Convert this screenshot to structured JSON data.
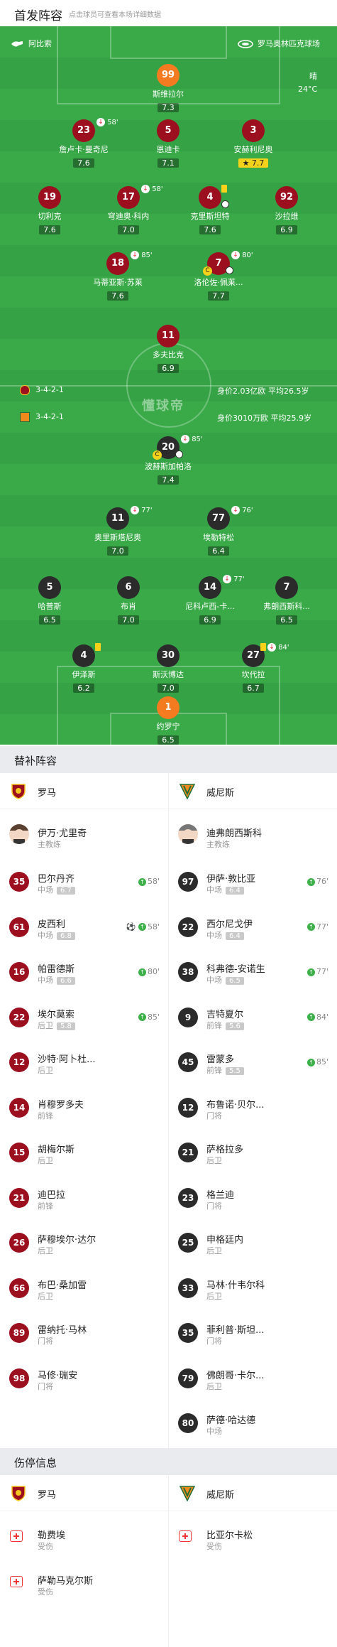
{
  "header": {
    "title": "首发阵容",
    "hint": "点击球员可查看本场详细数据"
  },
  "match": {
    "home_team": "阿比索",
    "stadium": "罗马奥林匹克球场",
    "weather": "晴",
    "temperature": "24°C",
    "watermark": "懂球帝"
  },
  "formations": {
    "home": {
      "formation": "3-4-2-1",
      "value": "身价2.03亿欧",
      "avg_age": "平均26.5岁"
    },
    "away": {
      "formation": "3-4-2-1",
      "value": "身价3010万欧",
      "avg_age": "平均25.9岁"
    }
  },
  "home_lineup": [
    {
      "num": "99",
      "name": "斯维拉尔",
      "rating": "7.3",
      "gk": true
    },
    {
      "num": "23",
      "name": "詹卢卡·曼奇尼",
      "rating": "7.6",
      "sub": "58'"
    },
    {
      "num": "5",
      "name": "恩迪卡",
      "rating": "7.1"
    },
    {
      "num": "3",
      "name": "安赫利尼奥",
      "rating": "7.7",
      "star": "7.7"
    },
    {
      "num": "19",
      "name": "切利克",
      "rating": "7.6"
    },
    {
      "num": "17",
      "name": "穹迪奥·科内",
      "rating": "7.0",
      "sub": "58'"
    },
    {
      "num": "4",
      "name": "克里斯坦特",
      "rating": "7.6",
      "card": true,
      "goal": true
    },
    {
      "num": "92",
      "name": "沙拉维",
      "rating": "6.9"
    },
    {
      "num": "18",
      "name": "马蒂亚斯·苏莱",
      "rating": "7.6",
      "sub": "85'"
    },
    {
      "num": "7",
      "name": "洛伦佐·佩莱...",
      "rating": "7.7",
      "sub": "80'",
      "captain": "C",
      "assist": true
    },
    {
      "num": "11",
      "name": "多夫比克",
      "rating": "6.9"
    }
  ],
  "away_lineup": [
    {
      "num": "20",
      "name": "波赫斯加帕洛",
      "rating": "7.4",
      "sub": "85'",
      "captain": "C",
      "goal": true
    },
    {
      "num": "11",
      "name": "奥里斯塔尼奥",
      "rating": "7.0",
      "sub": "77'"
    },
    {
      "num": "77",
      "name": "埃勒特松",
      "rating": "6.4",
      "sub": "76'"
    },
    {
      "num": "5",
      "name": "哈普斯",
      "rating": "6.5"
    },
    {
      "num": "6",
      "name": "布肖",
      "rating": "7.0"
    },
    {
      "num": "14",
      "name": "尼科卢西-卡...",
      "rating": "6.9",
      "sub": "77'"
    },
    {
      "num": "7",
      "name": "弗朗西斯科...",
      "rating": "6.5"
    },
    {
      "num": "4",
      "name": "伊泽斯",
      "rating": "6.2",
      "card": true
    },
    {
      "num": "30",
      "name": "斯沃博达",
      "rating": "7.0"
    },
    {
      "num": "27",
      "name": "坎代拉",
      "rating": "6.7",
      "sub": "84'",
      "card": true
    },
    {
      "num": "1",
      "name": "约罗宁",
      "rating": "6.5",
      "gk": true
    }
  ],
  "subs": {
    "title": "替补阵容",
    "home_team": "罗马",
    "away_team": "威尼斯",
    "home_coach": {
      "name": "伊万·尤里奇",
      "role": "主教练"
    },
    "away_coach": {
      "name": "迪弗朗西斯科",
      "role": "主教练"
    },
    "home": [
      {
        "num": "35",
        "name": "巴尔丹齐",
        "pos": "中场",
        "rating": "6.7",
        "in": "58'"
      },
      {
        "num": "61",
        "name": "皮西利",
        "pos": "中场",
        "rating": "6.8",
        "in": "58'",
        "goal": true
      },
      {
        "num": "16",
        "name": "帕雷德斯",
        "pos": "中场",
        "rating": "6.6",
        "in": "80'"
      },
      {
        "num": "22",
        "name": "埃尔莫索",
        "pos": "后卫",
        "rating": "5.8",
        "in": "85'"
      },
      {
        "num": "12",
        "name": "沙特·阿卜杜...",
        "pos": "后卫"
      },
      {
        "num": "14",
        "name": "肖穆罗多夫",
        "pos": "前锋"
      },
      {
        "num": "15",
        "name": "胡梅尔斯",
        "pos": "后卫"
      },
      {
        "num": "21",
        "name": "迪巴拉",
        "pos": "前锋"
      },
      {
        "num": "26",
        "name": "萨穆埃尔·达尔",
        "pos": "后卫"
      },
      {
        "num": "66",
        "name": "布巴·桑加雷",
        "pos": "后卫"
      },
      {
        "num": "89",
        "name": "雷纳托·马林",
        "pos": "门将"
      },
      {
        "num": "98",
        "name": "马修·瑞安",
        "pos": "门将"
      }
    ],
    "away": [
      {
        "num": "97",
        "name": "伊萨·敦比亚",
        "pos": "中场",
        "rating": "6.4",
        "in": "76'"
      },
      {
        "num": "22",
        "name": "西尔尼戈伊",
        "pos": "中场",
        "rating": "6.4",
        "in": "77'"
      },
      {
        "num": "38",
        "name": "科弗德-安诺生",
        "pos": "中场",
        "rating": "6.5",
        "in": "77'"
      },
      {
        "num": "9",
        "name": "吉特夏尔",
        "pos": "前锋",
        "rating": "5.6",
        "in": "84'"
      },
      {
        "num": "45",
        "name": "雷蒙多",
        "pos": "前锋",
        "rating": "5.5",
        "in": "85'"
      },
      {
        "num": "12",
        "name": "布鲁诺·贝尔...",
        "pos": "门将"
      },
      {
        "num": "21",
        "name": "萨格拉多",
        "pos": "后卫"
      },
      {
        "num": "23",
        "name": "格兰迪",
        "pos": "门将"
      },
      {
        "num": "25",
        "name": "申格廷内",
        "pos": "后卫"
      },
      {
        "num": "33",
        "name": "马林·什韦尔科",
        "pos": "后卫"
      },
      {
        "num": "35",
        "name": "菲利普·斯坦...",
        "pos": "门将"
      },
      {
        "num": "79",
        "name": "佛朗哥·卡尔...",
        "pos": "后卫"
      },
      {
        "num": "80",
        "name": "萨德·哈达德",
        "pos": "中场"
      }
    ]
  },
  "injuries": {
    "title": "伤停信息",
    "home_team": "罗马",
    "away_team": "威尼斯",
    "home": [
      {
        "name": "勒费埃",
        "status": "受伤"
      },
      {
        "name": "萨勒马克尔斯",
        "status": "受伤"
      }
    ],
    "away": [
      {
        "name": "比亚尔卡松",
        "status": "受伤"
      }
    ]
  },
  "colors": {
    "home": "#9b0f1f",
    "away": "#2b2b2b",
    "gk": "#f47b20",
    "pitch": "#3aaa49"
  }
}
